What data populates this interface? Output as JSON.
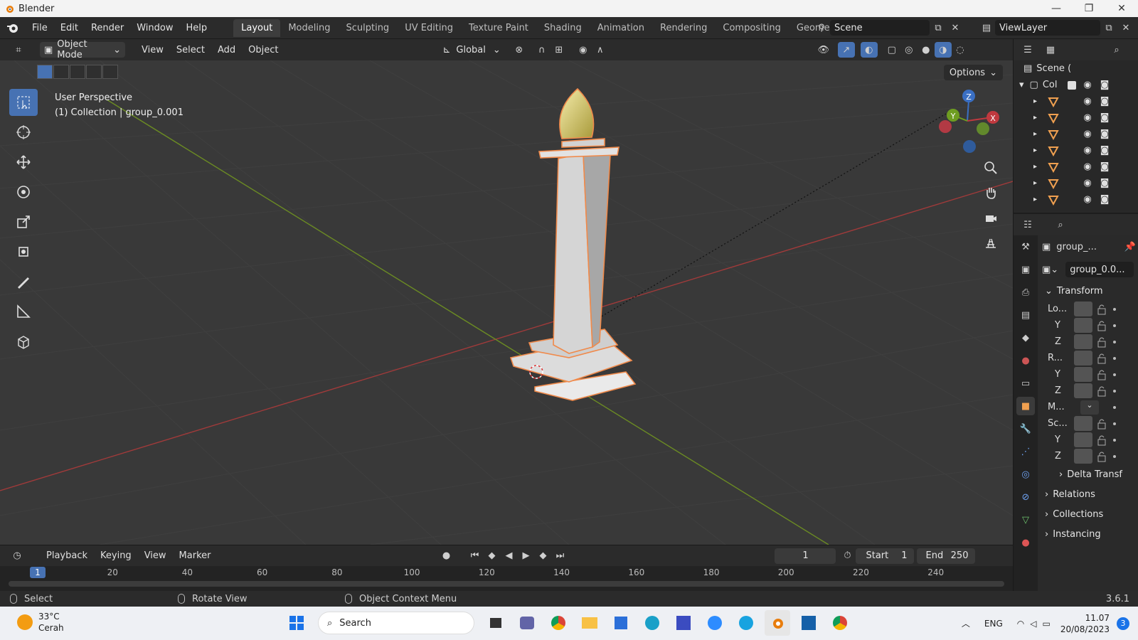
{
  "window": {
    "title": "Blender",
    "minimize": "—",
    "maximize": "❐",
    "close": "✕"
  },
  "menu": [
    "File",
    "Edit",
    "Render",
    "Window",
    "Help"
  ],
  "workspaces": [
    "Layout",
    "Modeling",
    "Sculpting",
    "UV Editing",
    "Texture Paint",
    "Shading",
    "Animation",
    "Rendering",
    "Compositing",
    "Geometry"
  ],
  "active_workspace": "Layout",
  "scene": {
    "name": "Scene",
    "view_layer": "ViewLayer"
  },
  "viewport_header": {
    "mode": "Object Mode",
    "menus": [
      "View",
      "Select",
      "Add",
      "Object"
    ],
    "orientation": "Global",
    "options": "Options"
  },
  "viewport": {
    "perspective": "User Perspective",
    "context": "(1) Collection | group_0.001",
    "gizmo_axes": {
      "x": "X",
      "y": "Y",
      "z": "Z"
    }
  },
  "outliner": {
    "scene_label": "Scene (",
    "collection_label": "Col",
    "object_rows": 7
  },
  "properties": {
    "object_name_short": "group_...",
    "object_data_name": "group_0.0...",
    "transform_label": "Transform",
    "location_label": "Lo...",
    "rotation_label": "R...",
    "mode_label": "M...",
    "scale_label": "Sc...",
    "y": "Y",
    "z": "Z",
    "delta": "Delta Transf",
    "relations": "Relations",
    "collections": "Collections",
    "instancing": "Instancing"
  },
  "timeline": {
    "menus": [
      "Playback",
      "Keying",
      "View",
      "Marker"
    ],
    "current_frame": "1",
    "start_label": "Start",
    "start": "1",
    "end_label": "End",
    "end": "250",
    "ruler": [
      "20",
      "40",
      "60",
      "80",
      "100",
      "120",
      "140",
      "160",
      "180",
      "200",
      "220",
      "240"
    ],
    "cursor": "1"
  },
  "statusbar": {
    "select": "Select",
    "rotate": "Rotate View",
    "context_menu": "Object Context Menu",
    "version": "3.6.1"
  },
  "taskbar": {
    "temp": "33°C",
    "weather": "Cerah",
    "search_placeholder": "Search",
    "lang": "ENG",
    "time": "11.07",
    "date": "20/08/2023",
    "notif_count": "3"
  },
  "colors": {
    "accent": "#4772b3",
    "select_outline": "#f08a4b",
    "x_axis": "#a03a3a",
    "y_axis": "#6b8b23"
  }
}
